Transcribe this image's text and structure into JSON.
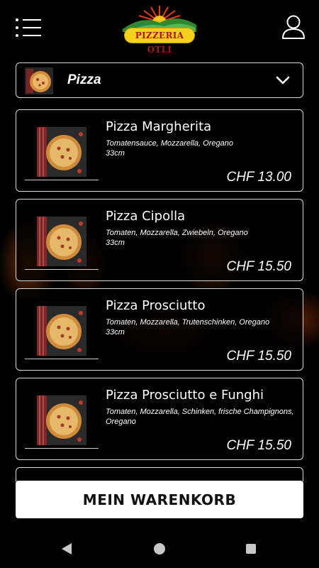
{
  "header": {
    "logo_text": "PIZZERIA OTLI",
    "menu_icon": "hamburger-menu-icon",
    "user_icon": "user-icon"
  },
  "category": {
    "selected": "Pizza",
    "icon": "chevron-down-icon"
  },
  "products": [
    {
      "name": "Pizza Margherita",
      "description": "Tomatensauce, Mozzarella, Oregano",
      "size": "33cm",
      "price": "CHF 13.00"
    },
    {
      "name": "Pizza Cipolla",
      "description": "Tomaten, Mozzarella, Zwiebeln, Oregano",
      "size": "33cm",
      "price": "CHF 15.50"
    },
    {
      "name": "Pizza Prosciutto",
      "description": "Tomaten, Mozzarella, Trutenschinken, Oregano",
      "size": "33cm",
      "price": "CHF 15.50"
    },
    {
      "name": "Pizza Prosciutto e Funghi",
      "description": "Tomaten, Mozzarella, Schinken, frische Champignons, Oregano",
      "size": "",
      "price": "CHF 15.50"
    }
  ],
  "cart": {
    "label": "MEIN WARENKORB"
  },
  "colors": {
    "background": "#000000",
    "logo_yellow": "#f4d21b",
    "logo_red": "#b3150f",
    "button_bg": "#ffffff"
  }
}
